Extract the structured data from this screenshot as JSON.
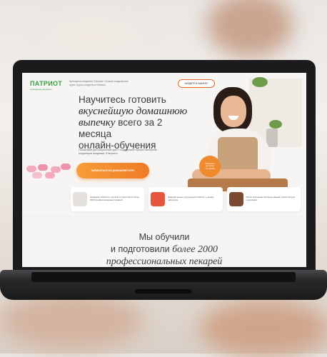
{
  "brand": {
    "name": "ПАТРИОТ",
    "tagline": "кулинарная академия"
  },
  "header": {
    "info": "Кулинарная академия «Патриот» Лучшие кондитерские курсы. Курсы кондитера в Алматы",
    "button_label": "ЗАЙДИТЕ В КАБИНЕТ"
  },
  "hero": {
    "line1": "Научитесь готовить",
    "line2": "вкуснейшую домашнюю",
    "line3_italic": "выпечку",
    "line3_rest": " всего за 2 месяца",
    "line4": "онлайн-обучения",
    "subtext": "Пошаговый дистанционный курс с поддержкой лучших экспертов-кондитеров академии «Патриот»",
    "cta_label": "ЗАПИСАТЬСЯ НА ДОМАШНИЙ КУРС"
  },
  "badge": {
    "line1": "Обучение",
    "line2": "доступно",
    "line3": "с 0 уровня"
  },
  "features": [
    {
      "icon": "mixer-icon",
      "text": "Академия «Патриот» обучила и подготовила более 2000 профессиональных пекарей"
    },
    {
      "icon": "stand-mixer-icon",
      "text": "Доведем рецепт до результата вместе с нашим экспертом"
    },
    {
      "icon": "bakery-icon",
      "text": "После окончания обучения каждый ученик получит сертификат"
    }
  ],
  "stat": {
    "line1": "Мы обучили",
    "line2_pre": "и подготовили ",
    "line2_italic": "более 2000",
    "line3": "профессиональных пекарей"
  },
  "colors": {
    "brand_green": "#36a041",
    "accent_orange": "#ef7b24"
  }
}
